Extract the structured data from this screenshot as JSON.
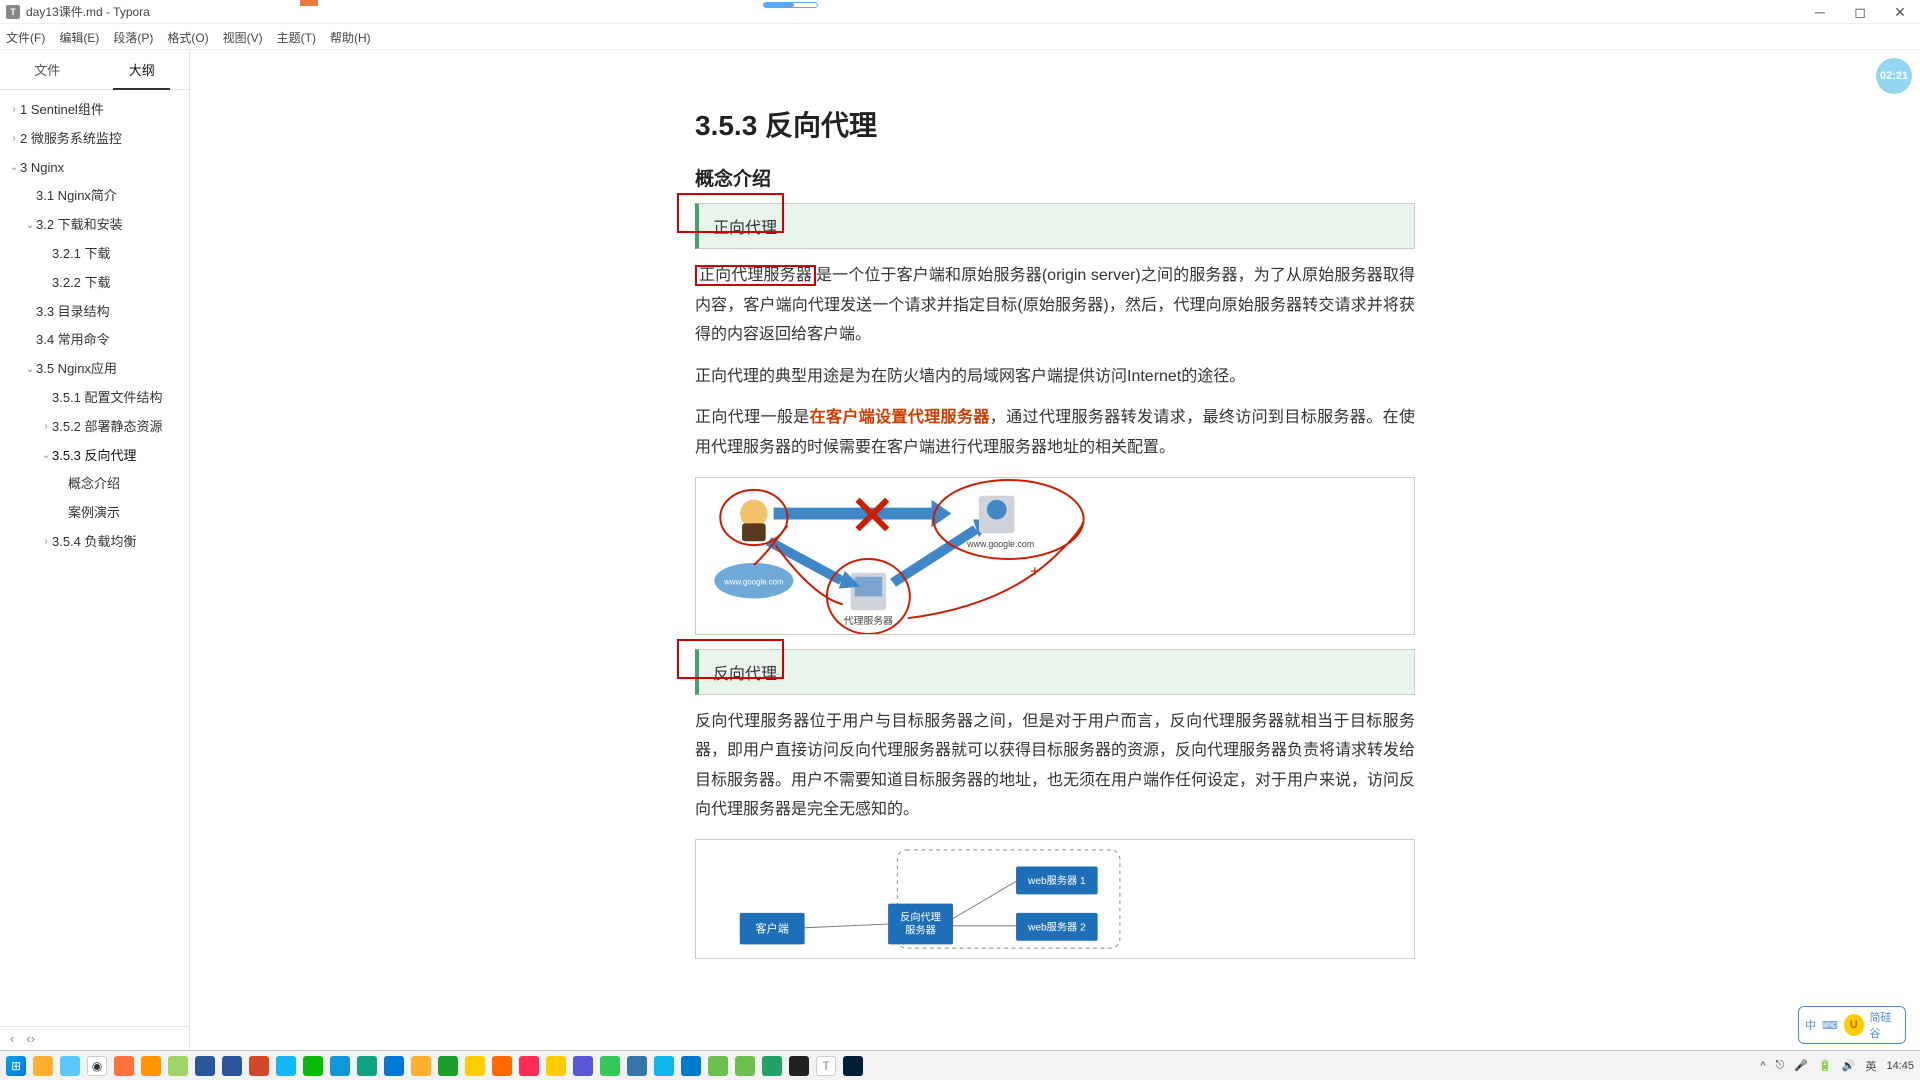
{
  "window": {
    "title": "day13课件.md - Typora"
  },
  "menus": [
    "文件(F)",
    "编辑(E)",
    "段落(P)",
    "格式(O)",
    "视图(V)",
    "主题(T)",
    "帮助(H)"
  ],
  "side_tabs": {
    "files": "文件",
    "outline": "大纲"
  },
  "outline": [
    {
      "lv": 1,
      "caret": "›",
      "t": "1 Sentinel组件"
    },
    {
      "lv": 1,
      "caret": "›",
      "t": "2 微服务系统监控"
    },
    {
      "lv": 1,
      "caret": "⌄",
      "t": "3 Nginx"
    },
    {
      "lv": 2,
      "caret": "",
      "t": "3.1 Nginx简介"
    },
    {
      "lv": 2,
      "caret": "⌄",
      "t": "3.2 下载和安装"
    },
    {
      "lv": 3,
      "caret": "",
      "t": "3.2.1 下载"
    },
    {
      "lv": 3,
      "caret": "",
      "t": "3.2.2 下载"
    },
    {
      "lv": 2,
      "caret": "",
      "t": "3.3 目录结构"
    },
    {
      "lv": 2,
      "caret": "",
      "t": "3.4 常用命令"
    },
    {
      "lv": 2,
      "caret": "⌄",
      "t": "3.5 Nginx应用"
    },
    {
      "lv": 3,
      "caret": "",
      "t": "3.5.1 配置文件结构"
    },
    {
      "lv": 3,
      "caret": "›",
      "t": "3.5.2 部署静态资源"
    },
    {
      "lv": 3,
      "caret": "⌄",
      "t": "3.5.3 反向代理",
      "cur": true
    },
    {
      "lv": 4,
      "caret": "",
      "t": "概念介绍"
    },
    {
      "lv": 4,
      "caret": "",
      "t": "案例演示"
    },
    {
      "lv": 3,
      "caret": "›",
      "t": "3.5.4 负载均衡"
    }
  ],
  "doc": {
    "h3": "3.5.3 反向代理",
    "h4": "概念介绍",
    "quote1": "正向代理",
    "p1_boxed": "正向代理服务器",
    "p1_rest": "是一个位于客户端和原始服务器(origin server)之间的服务器，为了从原始服务器取得内容，客户端向代理发送一个请求并指定目标(原始服务器)，然后，代理向原始服务器转交请求并将获得的内容返回给客户端。",
    "p2": "正向代理的典型用途是为在防火墙内的局域网客户端提供访问Internet的途径。",
    "p3_a": "正向代理一般是",
    "p3_b": "在客户端设置代理服务器",
    "p3_c": "，通过代理服务器转发请求，最终访问到目标服务器。在使用代理服务器的时候需要在客户端进行代理服务器地址的相关配置。",
    "diag1": {
      "client": "www.google.com",
      "proxy": "代理服务器",
      "cloud": "www.google.com"
    },
    "quote2": "反向代理",
    "p4": "反向代理服务器位于用户与目标服务器之间，但是对于用户而言，反向代理服务器就相当于目标服务器，即用户直接访问反向代理服务器就可以获得目标服务器的资源，反向代理服务器负责将请求转发给目标服务器。用户不需要知道目标服务器的地址，也无须在用户端作任何设定，对于用户来说，访问反向代理服务器是完全无感知的。",
    "diag2": {
      "client": "客户端",
      "proxy": "反向代理\n服务器",
      "web1": "web服务器 1",
      "web2": "web服务器 2"
    }
  },
  "badge_time": "02:21",
  "clock": "14:45",
  "ime": "中 简硅谷"
}
